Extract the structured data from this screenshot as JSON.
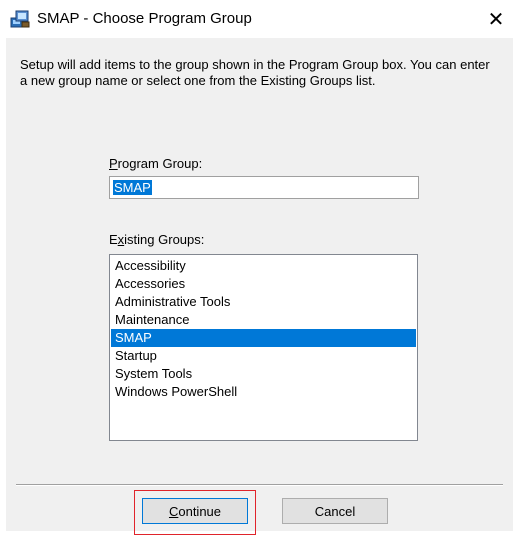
{
  "window": {
    "title": "SMAP - Choose Program Group",
    "close_glyph": "✕",
    "app_icon": "setup-computer-icon"
  },
  "intro_text": "Setup will add items to the group shown in the Program Group box. You can enter a new group name or select one from the Existing Groups list.",
  "program_group": {
    "label_accel": "P",
    "label_rest": "rogram Group:",
    "value": "SMAP"
  },
  "existing_groups": {
    "label_pre": "E",
    "label_accel": "x",
    "label_rest": "isting Groups:",
    "items": [
      "Accessibility",
      "Accessories",
      "Administrative Tools",
      "Maintenance",
      "SMAP",
      "Startup",
      "System Tools",
      "Windows PowerShell"
    ],
    "selected": "SMAP"
  },
  "buttons": {
    "continue_accel": "C",
    "continue_rest": "ontinue",
    "cancel": "Cancel"
  },
  "colors": {
    "selection": "#0078d7",
    "highlight_box": "#e0242b",
    "dialog_bg": "#f0f0f0"
  }
}
